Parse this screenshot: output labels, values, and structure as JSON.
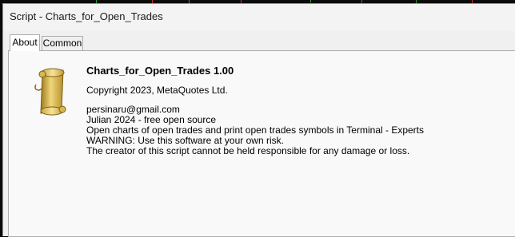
{
  "window": {
    "title": "Script - Charts_for_Open_Trades"
  },
  "tabs": [
    {
      "label": "About",
      "active": true
    },
    {
      "label": "Common",
      "active": false
    }
  ],
  "about": {
    "icon": "scroll-icon",
    "program_name": "Charts_for_Open_Trades 1.00",
    "copyright": "Copyright 2023, MetaQuotes Ltd.",
    "description_lines": [
      "persinaru@gmail.com",
      "Julian 2024 - free open source",
      "Open charts of open trades and print open trades symbols in Terminal - Experts",
      "WARNING: Use this software at your own risk.",
      "The creator of this script cannot be held responsible for any damage or loss."
    ]
  },
  "colors": {
    "dialog_bg": "#f0f0f0",
    "panel_bg": "#f9f9f9",
    "scroll_gold": "#d9b64a",
    "chart_bull": "#2f9a3a",
    "chart_bear": "#c8352f"
  }
}
